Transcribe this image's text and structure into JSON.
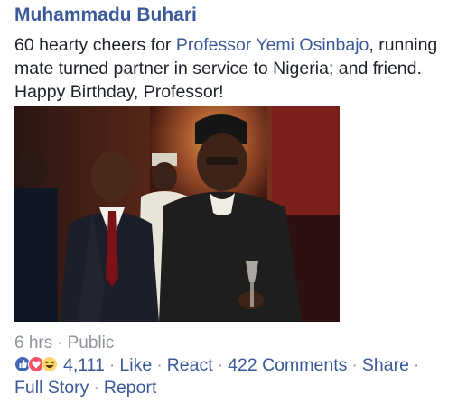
{
  "post": {
    "author": "Muhammadu Buhari",
    "message_before": "60 hearty cheers for ",
    "mention": "Professor Yemi Osinbajo",
    "message_after": ", running mate turned partner in service to Nigeria; and friend. Happy Birthday, Professor!",
    "time": "6 hrs",
    "privacy": "Public",
    "separator": "·",
    "reaction_icons": [
      "like-icon",
      "love-icon",
      "haha-icon"
    ],
    "reaction_count": "4,111",
    "actions": {
      "like": "Like",
      "react": "React",
      "comments": "422 Comments",
      "share": "Share",
      "full_story": "Full Story",
      "report": "Report"
    }
  },
  "colors": {
    "author": "#3b5998",
    "text": "#1d2129",
    "meta": "#90949c",
    "like_blue": "#4267b2",
    "love_red": "#f25268",
    "haha_yellow": "#fcd669"
  }
}
